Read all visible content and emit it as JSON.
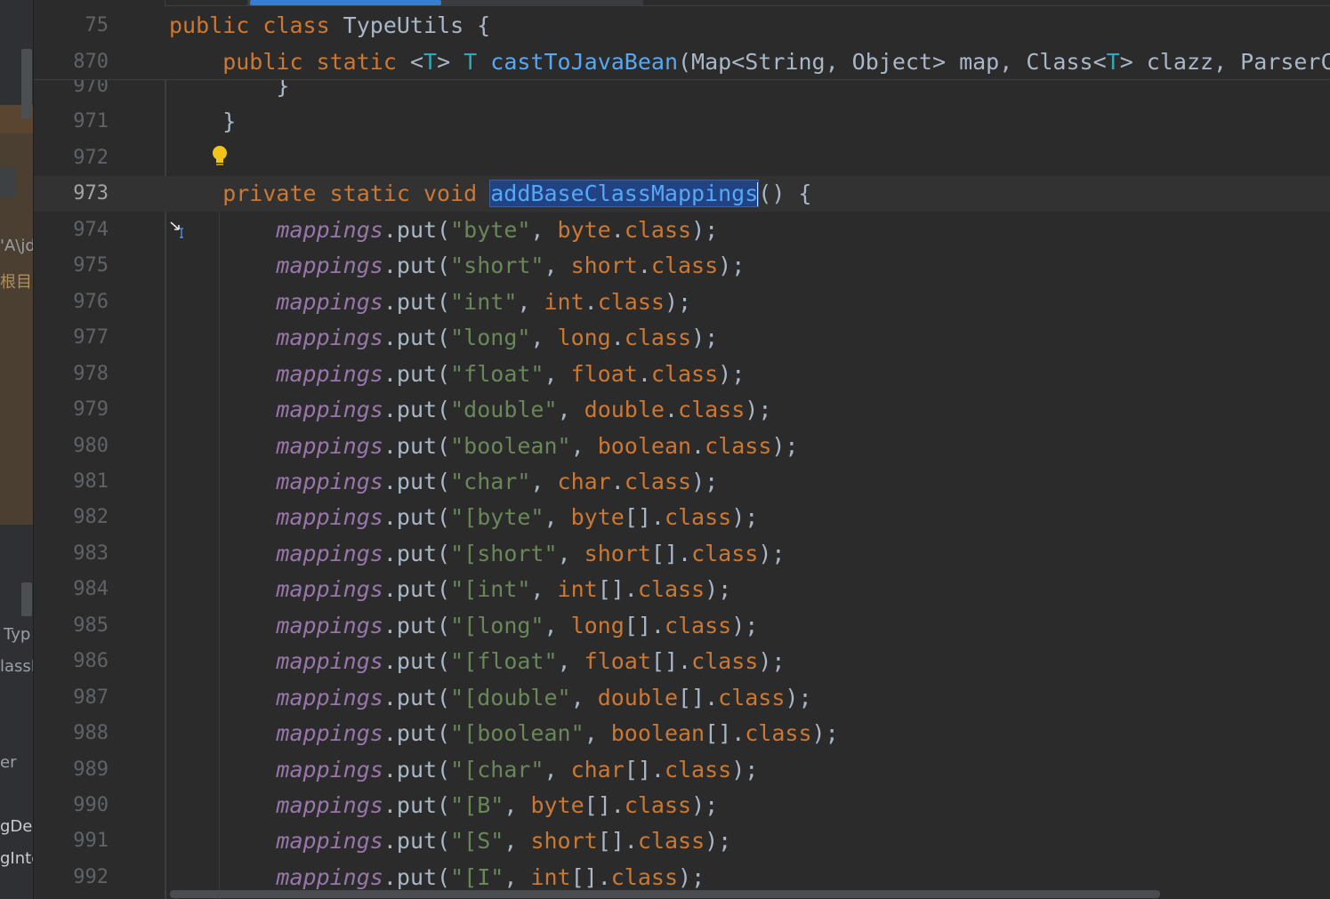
{
  "left_panel": {
    "fragments": [
      "'A\\jd",
      "根目录",
      "Typ",
      "lassM",
      "er",
      "gDe",
      "gInte"
    ]
  },
  "sticky_header": [
    {
      "line_number": "75",
      "tokens": [
        {
          "t": "public class ",
          "c": "kw"
        },
        {
          "t": "TypeUtils {",
          "c": "plain"
        }
      ]
    },
    {
      "line_number": "870",
      "tokens": [
        {
          "t": "    public static ",
          "c": "kw"
        },
        {
          "t": "<",
          "c": "plain"
        },
        {
          "t": "T",
          "c": "tp"
        },
        {
          "t": "> ",
          "c": "plain"
        },
        {
          "t": "T ",
          "c": "tp"
        },
        {
          "t": "castToJavaBean",
          "c": "fn"
        },
        {
          "t": "(Map<String, Object> map, Class<",
          "c": "plain"
        },
        {
          "t": "T",
          "c": "tp"
        },
        {
          "t": "> clazz, ParserC",
          "c": "plain"
        }
      ]
    }
  ],
  "lines": [
    {
      "line_number": "970",
      "tokens": [
        {
          "t": "        }",
          "c": "plain"
        }
      ]
    },
    {
      "line_number": "971",
      "tokens": [
        {
          "t": "    }",
          "c": "plain"
        }
      ]
    },
    {
      "line_number": "972",
      "tokens": []
    },
    {
      "line_number": "973",
      "current": true,
      "tokens": [
        {
          "t": "    private static void ",
          "c": "kw"
        },
        {
          "t": "addBaseClassMappings",
          "c": "fn",
          "selected": true
        },
        {
          "t": "() {",
          "c": "plain"
        }
      ]
    },
    {
      "line_number": "974",
      "tokens": [
        {
          "t": "        ",
          "c": "plain"
        },
        {
          "t": "mappings",
          "c": "fld"
        },
        {
          "t": ".put(",
          "c": "plain"
        },
        {
          "t": "\"byte\"",
          "c": "str"
        },
        {
          "t": ", ",
          "c": "plain"
        },
        {
          "t": "byte",
          "c": "kw"
        },
        {
          "t": ".",
          "c": "plain"
        },
        {
          "t": "class",
          "c": "kw"
        },
        {
          "t": ");",
          "c": "plain"
        }
      ]
    },
    {
      "line_number": "975",
      "tokens": [
        {
          "t": "        ",
          "c": "plain"
        },
        {
          "t": "mappings",
          "c": "fld"
        },
        {
          "t": ".put(",
          "c": "plain"
        },
        {
          "t": "\"short\"",
          "c": "str"
        },
        {
          "t": ", ",
          "c": "plain"
        },
        {
          "t": "short",
          "c": "kw"
        },
        {
          "t": ".",
          "c": "plain"
        },
        {
          "t": "class",
          "c": "kw"
        },
        {
          "t": ");",
          "c": "plain"
        }
      ]
    },
    {
      "line_number": "976",
      "tokens": [
        {
          "t": "        ",
          "c": "plain"
        },
        {
          "t": "mappings",
          "c": "fld"
        },
        {
          "t": ".put(",
          "c": "plain"
        },
        {
          "t": "\"int\"",
          "c": "str"
        },
        {
          "t": ", ",
          "c": "plain"
        },
        {
          "t": "int",
          "c": "kw"
        },
        {
          "t": ".",
          "c": "plain"
        },
        {
          "t": "class",
          "c": "kw"
        },
        {
          "t": ");",
          "c": "plain"
        }
      ]
    },
    {
      "line_number": "977",
      "tokens": [
        {
          "t": "        ",
          "c": "plain"
        },
        {
          "t": "mappings",
          "c": "fld"
        },
        {
          "t": ".put(",
          "c": "plain"
        },
        {
          "t": "\"long\"",
          "c": "str"
        },
        {
          "t": ", ",
          "c": "plain"
        },
        {
          "t": "long",
          "c": "kw"
        },
        {
          "t": ".",
          "c": "plain"
        },
        {
          "t": "class",
          "c": "kw"
        },
        {
          "t": ");",
          "c": "plain"
        }
      ]
    },
    {
      "line_number": "978",
      "tokens": [
        {
          "t": "        ",
          "c": "plain"
        },
        {
          "t": "mappings",
          "c": "fld"
        },
        {
          "t": ".put(",
          "c": "plain"
        },
        {
          "t": "\"float\"",
          "c": "str"
        },
        {
          "t": ", ",
          "c": "plain"
        },
        {
          "t": "float",
          "c": "kw"
        },
        {
          "t": ".",
          "c": "plain"
        },
        {
          "t": "class",
          "c": "kw"
        },
        {
          "t": ");",
          "c": "plain"
        }
      ]
    },
    {
      "line_number": "979",
      "tokens": [
        {
          "t": "        ",
          "c": "plain"
        },
        {
          "t": "mappings",
          "c": "fld"
        },
        {
          "t": ".put(",
          "c": "plain"
        },
        {
          "t": "\"double\"",
          "c": "str"
        },
        {
          "t": ", ",
          "c": "plain"
        },
        {
          "t": "double",
          "c": "kw"
        },
        {
          "t": ".",
          "c": "plain"
        },
        {
          "t": "class",
          "c": "kw"
        },
        {
          "t": ");",
          "c": "plain"
        }
      ]
    },
    {
      "line_number": "980",
      "tokens": [
        {
          "t": "        ",
          "c": "plain"
        },
        {
          "t": "mappings",
          "c": "fld"
        },
        {
          "t": ".put(",
          "c": "plain"
        },
        {
          "t": "\"boolean\"",
          "c": "str"
        },
        {
          "t": ", ",
          "c": "plain"
        },
        {
          "t": "boolean",
          "c": "kw"
        },
        {
          "t": ".",
          "c": "plain"
        },
        {
          "t": "class",
          "c": "kw"
        },
        {
          "t": ");",
          "c": "plain"
        }
      ]
    },
    {
      "line_number": "981",
      "tokens": [
        {
          "t": "        ",
          "c": "plain"
        },
        {
          "t": "mappings",
          "c": "fld"
        },
        {
          "t": ".put(",
          "c": "plain"
        },
        {
          "t": "\"char\"",
          "c": "str"
        },
        {
          "t": ", ",
          "c": "plain"
        },
        {
          "t": "char",
          "c": "kw"
        },
        {
          "t": ".",
          "c": "plain"
        },
        {
          "t": "class",
          "c": "kw"
        },
        {
          "t": ");",
          "c": "plain"
        }
      ]
    },
    {
      "line_number": "982",
      "tokens": [
        {
          "t": "        ",
          "c": "plain"
        },
        {
          "t": "mappings",
          "c": "fld"
        },
        {
          "t": ".put(",
          "c": "plain"
        },
        {
          "t": "\"[byte\"",
          "c": "str"
        },
        {
          "t": ", ",
          "c": "plain"
        },
        {
          "t": "byte",
          "c": "kw"
        },
        {
          "t": "[].",
          "c": "plain"
        },
        {
          "t": "class",
          "c": "kw"
        },
        {
          "t": ");",
          "c": "plain"
        }
      ]
    },
    {
      "line_number": "983",
      "tokens": [
        {
          "t": "        ",
          "c": "plain"
        },
        {
          "t": "mappings",
          "c": "fld"
        },
        {
          "t": ".put(",
          "c": "plain"
        },
        {
          "t": "\"[short\"",
          "c": "str"
        },
        {
          "t": ", ",
          "c": "plain"
        },
        {
          "t": "short",
          "c": "kw"
        },
        {
          "t": "[].",
          "c": "plain"
        },
        {
          "t": "class",
          "c": "kw"
        },
        {
          "t": ");",
          "c": "plain"
        }
      ]
    },
    {
      "line_number": "984",
      "tokens": [
        {
          "t": "        ",
          "c": "plain"
        },
        {
          "t": "mappings",
          "c": "fld"
        },
        {
          "t": ".put(",
          "c": "plain"
        },
        {
          "t": "\"[int\"",
          "c": "str"
        },
        {
          "t": ", ",
          "c": "plain"
        },
        {
          "t": "int",
          "c": "kw"
        },
        {
          "t": "[].",
          "c": "plain"
        },
        {
          "t": "class",
          "c": "kw"
        },
        {
          "t": ");",
          "c": "plain"
        }
      ]
    },
    {
      "line_number": "985",
      "tokens": [
        {
          "t": "        ",
          "c": "plain"
        },
        {
          "t": "mappings",
          "c": "fld"
        },
        {
          "t": ".put(",
          "c": "plain"
        },
        {
          "t": "\"[long\"",
          "c": "str"
        },
        {
          "t": ", ",
          "c": "plain"
        },
        {
          "t": "long",
          "c": "kw"
        },
        {
          "t": "[].",
          "c": "plain"
        },
        {
          "t": "class",
          "c": "kw"
        },
        {
          "t": ");",
          "c": "plain"
        }
      ]
    },
    {
      "line_number": "986",
      "tokens": [
        {
          "t": "        ",
          "c": "plain"
        },
        {
          "t": "mappings",
          "c": "fld"
        },
        {
          "t": ".put(",
          "c": "plain"
        },
        {
          "t": "\"[float\"",
          "c": "str"
        },
        {
          "t": ", ",
          "c": "plain"
        },
        {
          "t": "float",
          "c": "kw"
        },
        {
          "t": "[].",
          "c": "plain"
        },
        {
          "t": "class",
          "c": "kw"
        },
        {
          "t": ");",
          "c": "plain"
        }
      ]
    },
    {
      "line_number": "987",
      "tokens": [
        {
          "t": "        ",
          "c": "plain"
        },
        {
          "t": "mappings",
          "c": "fld"
        },
        {
          "t": ".put(",
          "c": "plain"
        },
        {
          "t": "\"[double\"",
          "c": "str"
        },
        {
          "t": ", ",
          "c": "plain"
        },
        {
          "t": "double",
          "c": "kw"
        },
        {
          "t": "[].",
          "c": "plain"
        },
        {
          "t": "class",
          "c": "kw"
        },
        {
          "t": ");",
          "c": "plain"
        }
      ]
    },
    {
      "line_number": "988",
      "tokens": [
        {
          "t": "        ",
          "c": "plain"
        },
        {
          "t": "mappings",
          "c": "fld"
        },
        {
          "t": ".put(",
          "c": "plain"
        },
        {
          "t": "\"[boolean\"",
          "c": "str"
        },
        {
          "t": ", ",
          "c": "plain"
        },
        {
          "t": "boolean",
          "c": "kw"
        },
        {
          "t": "[].",
          "c": "plain"
        },
        {
          "t": "class",
          "c": "kw"
        },
        {
          "t": ");",
          "c": "plain"
        }
      ]
    },
    {
      "line_number": "989",
      "tokens": [
        {
          "t": "        ",
          "c": "plain"
        },
        {
          "t": "mappings",
          "c": "fld"
        },
        {
          "t": ".put(",
          "c": "plain"
        },
        {
          "t": "\"[char\"",
          "c": "str"
        },
        {
          "t": ", ",
          "c": "plain"
        },
        {
          "t": "char",
          "c": "kw"
        },
        {
          "t": "[].",
          "c": "plain"
        },
        {
          "t": "class",
          "c": "kw"
        },
        {
          "t": ");",
          "c": "plain"
        }
      ]
    },
    {
      "line_number": "990",
      "tokens": [
        {
          "t": "        ",
          "c": "plain"
        },
        {
          "t": "mappings",
          "c": "fld"
        },
        {
          "t": ".put(",
          "c": "plain"
        },
        {
          "t": "\"[B\"",
          "c": "str"
        },
        {
          "t": ", ",
          "c": "plain"
        },
        {
          "t": "byte",
          "c": "kw"
        },
        {
          "t": "[].",
          "c": "plain"
        },
        {
          "t": "class",
          "c": "kw"
        },
        {
          "t": ");",
          "c": "plain"
        }
      ]
    },
    {
      "line_number": "991",
      "tokens": [
        {
          "t": "        ",
          "c": "plain"
        },
        {
          "t": "mappings",
          "c": "fld"
        },
        {
          "t": ".put(",
          "c": "plain"
        },
        {
          "t": "\"[S\"",
          "c": "str"
        },
        {
          "t": ", ",
          "c": "plain"
        },
        {
          "t": "short",
          "c": "kw"
        },
        {
          "t": "[].",
          "c": "plain"
        },
        {
          "t": "class",
          "c": "kw"
        },
        {
          "t": ");",
          "c": "plain"
        }
      ]
    },
    {
      "line_number": "992",
      "tokens": [
        {
          "t": "        ",
          "c": "plain"
        },
        {
          "t": "mappings",
          "c": "fld"
        },
        {
          "t": ".put(",
          "c": "plain"
        },
        {
          "t": "\"[I\"",
          "c": "str"
        },
        {
          "t": ", ",
          "c": "plain"
        },
        {
          "t": "int",
          "c": "kw"
        },
        {
          "t": "[].",
          "c": "plain"
        },
        {
          "t": "class",
          "c": "kw"
        },
        {
          "t": ");",
          "c": "plain"
        }
      ]
    }
  ],
  "colors": {
    "keyword": "#cc7832",
    "string": "#6a8759",
    "field": "#9876aa",
    "method": "#56a8f5",
    "type_param": "#2fa8b8",
    "plain": "#a9b7c6",
    "selection": "#214283",
    "current_line": "#323232"
  },
  "icons": {
    "intention": "lightbulb-icon",
    "cursor": "mouse-pointer-icon"
  }
}
